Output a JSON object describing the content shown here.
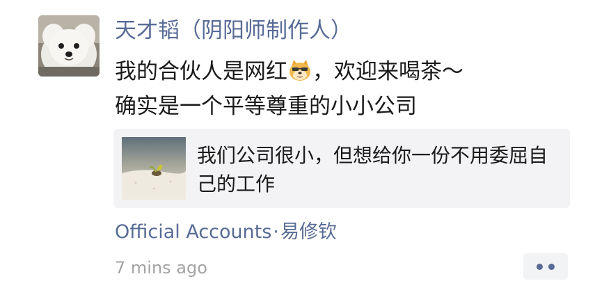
{
  "post": {
    "author_name": "天才韬（阴阳师制作人）",
    "text_line1_before": "我的合伙人是网红",
    "text_line1_after": "，欢迎来喝茶～",
    "text_line2": "确实是一个平等尊重的小小公司",
    "inline_emoji": "doge-emoji",
    "link_card": {
      "title": "我们公司很小，但想给你一份不用委屈自己的工作"
    },
    "source": {
      "label": "Official Accounts",
      "separator": "·",
      "account": "易修钦"
    },
    "timestamp": "7 mins ago",
    "more_icon": "more-dots-icon"
  },
  "colors": {
    "link_blue": "#576b95",
    "text": "#1a1a1a",
    "muted": "#a3a3a3",
    "card_bg": "#f3f3f5"
  }
}
